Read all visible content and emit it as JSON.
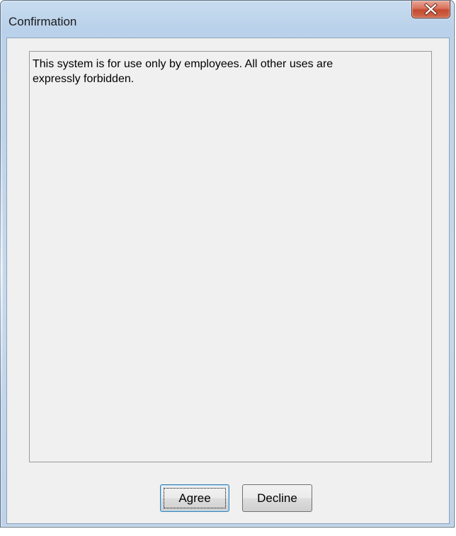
{
  "window": {
    "title": "Confirmation"
  },
  "titlebar": {
    "close_icon": "close-x-icon"
  },
  "message": {
    "text": "This system is for use only by employees. All other uses are\nexpressly forbidden."
  },
  "buttons": {
    "agree_label": "Agree",
    "decline_label": "Decline"
  },
  "colors": {
    "frame": "#bcd3ea",
    "client": "#f0f0f0",
    "close_button": "#c44a30",
    "default_button_border": "#3c7fb1"
  }
}
